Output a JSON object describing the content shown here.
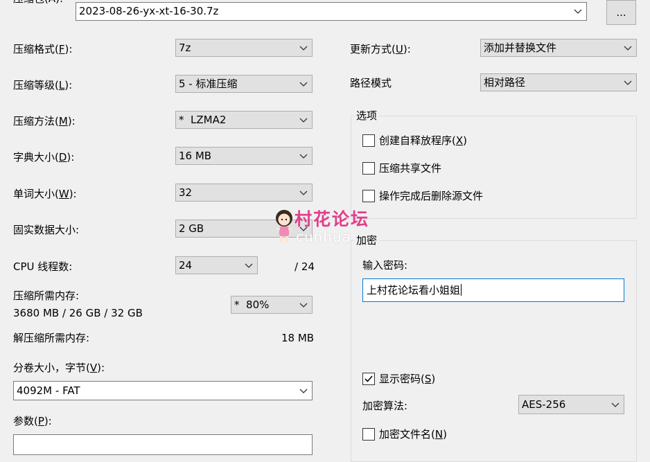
{
  "archive": {
    "label": "压缩包(A):",
    "path": "2023-08-26-yx-xt-16-30.7z",
    "browse_label": "..."
  },
  "left": {
    "format": {
      "label_prefix": "压缩格式(",
      "key": "F",
      "label_suffix": "):",
      "value": "7z"
    },
    "level": {
      "label_prefix": "压缩等级(",
      "key": "L",
      "label_suffix": "):",
      "value": "5 - 标准压缩"
    },
    "method": {
      "label_prefix": "压缩方法(",
      "key": "M",
      "label_suffix": "):",
      "value": "*  LZMA2"
    },
    "dict": {
      "label_prefix": "字典大小(",
      "key": "D",
      "label_suffix": "):",
      "value": "16 MB"
    },
    "word": {
      "label_prefix": "单词大小(",
      "key": "W",
      "label_suffix": "):",
      "value": "32"
    },
    "solid": {
      "label": "固实数据大小:",
      "value": "2 GB"
    },
    "threads": {
      "label": "CPU 线程数:",
      "value": "24",
      "max": "/ 24"
    },
    "mem_compress": {
      "label": "压缩所需内存:",
      "value": "3680 MB / 26 GB / 32 GB",
      "percent": "*  80%"
    },
    "mem_decompress": {
      "label": "解压缩所需内存:",
      "value": "18 MB"
    },
    "volume": {
      "label_prefix": "分卷大小，字节(",
      "key": "V",
      "label_suffix": "):",
      "value": "4092M - FAT"
    },
    "params": {
      "label_prefix": "参数(",
      "key": "P",
      "label_suffix": "):",
      "value": ""
    }
  },
  "right": {
    "update": {
      "label_prefix": "更新方式(",
      "key": "U",
      "label_suffix": "):",
      "value": "添加并替换文件"
    },
    "path_mode": {
      "label": "路径模式",
      "value": "相对路径"
    },
    "options": {
      "title": "选项",
      "sfx": {
        "label_prefix": "创建自释放程序(",
        "key": "X",
        "label_suffix": ")",
        "checked": false
      },
      "shared": {
        "label": "压缩共享文件",
        "checked": false
      },
      "delete": {
        "label": "操作完成后删除源文件",
        "checked": false
      }
    },
    "encryption": {
      "title": "加密",
      "password_label": "输入密码:",
      "password_value": "上村花论坛看小姐姐",
      "show_pw": {
        "label_prefix": "显示密码(",
        "key": "S",
        "label_suffix": ")",
        "checked": true
      },
      "algo_label": "加密算法:",
      "algo_value": "AES-256",
      "encrypt_names": {
        "label_prefix": "加密文件名(",
        "key": "N",
        "label_suffix": ")",
        "checked": false
      }
    }
  },
  "watermark": {
    "title": "村花论坛",
    "sub": "cunhua"
  }
}
